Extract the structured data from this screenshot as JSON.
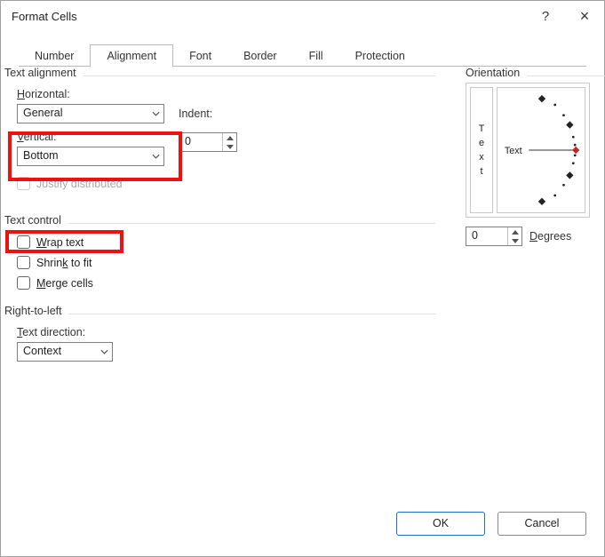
{
  "title": "Format Cells",
  "help_glyph": "?",
  "close_glyph": "×",
  "tabs": [
    "Number",
    "Alignment",
    "Font",
    "Border",
    "Fill",
    "Protection"
  ],
  "active_tab": 1,
  "text_alignment": {
    "title": "Text alignment",
    "horizontal_label": "Horizontal:",
    "horizontal_value": "General",
    "vertical_label": "Vertical:",
    "vertical_value": "Bottom",
    "indent_label": "Indent:",
    "indent_value": "0",
    "justify_label": "Justify distributed"
  },
  "text_control": {
    "title": "Text control",
    "wrap_label": "Wrap text",
    "shrink_label": "Shrink to fit",
    "merge_label": "Merge cells"
  },
  "rtl": {
    "title": "Right-to-left",
    "direction_label": "Text direction:",
    "direction_value": "Context"
  },
  "orientation": {
    "title": "Orientation",
    "vtext": [
      "T",
      "e",
      "x",
      "t"
    ],
    "text_label": "Text",
    "degrees_value": "0",
    "degrees_label": "Degrees"
  },
  "buttons": {
    "ok": "OK",
    "cancel": "Cancel"
  }
}
